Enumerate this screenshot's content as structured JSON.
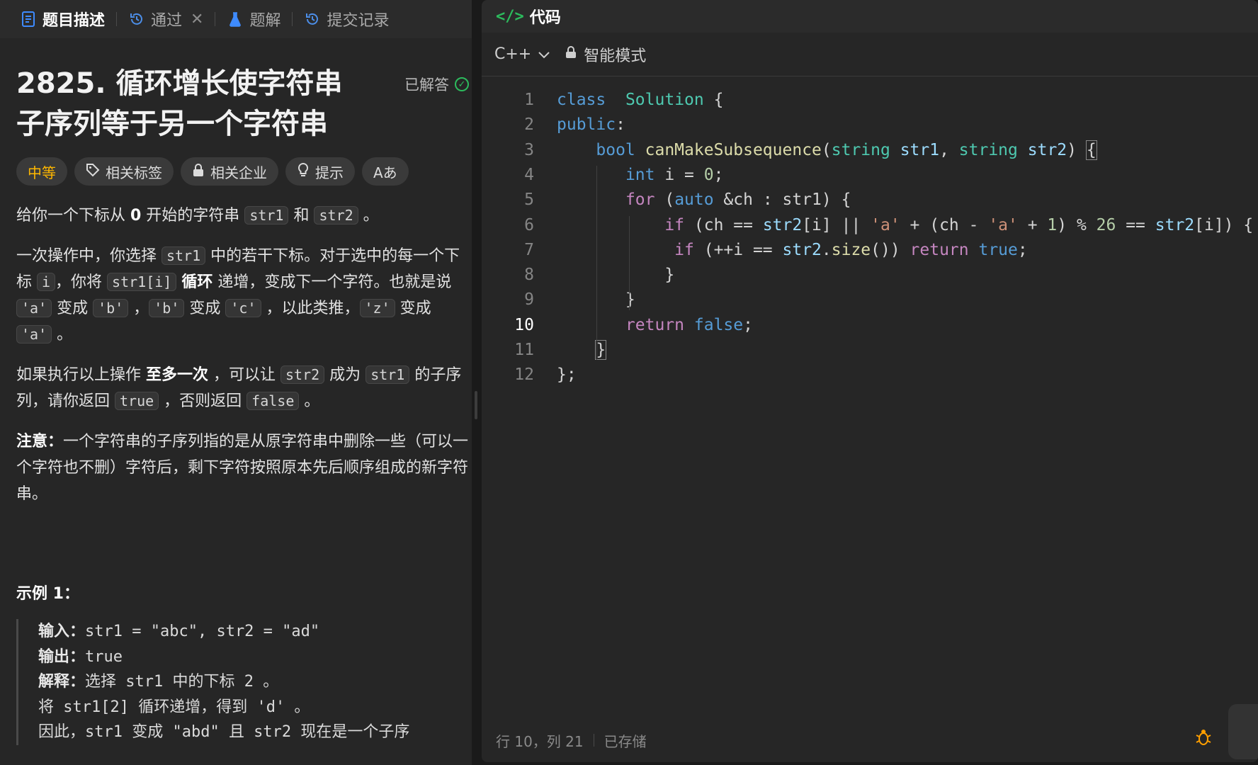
{
  "left_tabs": [
    {
      "label": "题目描述",
      "icon": "doc-icon",
      "active": true
    },
    {
      "label": "通过",
      "icon": "history-icon",
      "closable": true
    },
    {
      "label": "题解",
      "icon": "flask-icon"
    },
    {
      "label": "提交记录",
      "icon": "history-icon"
    }
  ],
  "problem": {
    "title": "2825. 循环增长使字符串子序列等于另一个字符串",
    "status": "已解答",
    "chips": [
      {
        "label": "中等",
        "icon": ""
      },
      {
        "label": "相关标签",
        "icon": "tag-icon"
      },
      {
        "label": "相关企业",
        "icon": "lock-icon"
      },
      {
        "label": "提示",
        "icon": "bulb-icon"
      },
      {
        "label": "Aあ",
        "icon": "font-size-icon"
      }
    ],
    "p1": {
      "a": "给你一个下标从 ",
      "b": "0",
      "c": " 开始的字符串 ",
      "c1": "str1",
      "d": " 和 ",
      "c2": "str2",
      "e": " 。"
    },
    "p2": {
      "a": "一次操作中，你选择 ",
      "c1": "str1",
      "b": " 中的若干下标。对于选中的每一个下标 ",
      "c2": "i",
      "c": "，你将 ",
      "c3": "str1[i]",
      "d": " ",
      "bold": "循环",
      "e": " 递增，变成下一个字符。也就是说 ",
      "c4": "'a'",
      "f": " 变成 ",
      "c5": "'b'",
      "g": " ，",
      "c6": "'b'",
      "h": " 变成 ",
      "c7": "'c'",
      "i": " ，以此类推，",
      "c8": "'z'",
      "j": " 变成 ",
      "c9": "'a'",
      "k": " 。"
    },
    "p3": {
      "a": "如果执行以上操作 ",
      "bold": "至多一次",
      "b": " ，可以让 ",
      "c1": "str2",
      "c": " 成为 ",
      "c2": "str1",
      "d": " 的子序列，请你返回 ",
      "c3": "true",
      "e": " ，否则返回 ",
      "c4": "false",
      "f": " 。"
    },
    "p4": {
      "bold": "注意：",
      "a": "一个字符串的子序列指的是从原字符串中删除一些（可以一个字符也不删）字符后，剩下字符按照原本先后顺序组成的新字符串。"
    },
    "example_title": "示例 1：",
    "example_lines": [
      {
        "k": "输入：",
        "v": "str1 = \"abc\", str2 = \"ad\""
      },
      {
        "k": "输出：",
        "v": "true"
      },
      {
        "k": "解释：",
        "v": "选择 str1 中的下标 2 。"
      },
      {
        "k": "",
        "v": "将 str1[2] 循环递增，得到 'd' 。"
      },
      {
        "k": "",
        "v": "因此，str1 变成 \"abd\" 且 str2 现在是一个子序"
      }
    ]
  },
  "editor": {
    "header_title": "代码",
    "language": "C++",
    "mode": "智能模式",
    "current_line": 10,
    "status_position": "行 10，列 21",
    "status_saved": "已存储",
    "lines": [
      [
        [
          "kw",
          "class"
        ],
        [
          "",
          "  "
        ],
        [
          "ty",
          "Solution"
        ],
        [
          "",
          " {"
        ]
      ],
      [
        [
          "kw",
          "public"
        ],
        [
          "",
          ":"
        ]
      ],
      [
        [
          "",
          "    "
        ],
        [
          "kw",
          "bool"
        ],
        [
          "",
          " "
        ],
        [
          "fn",
          "canMakeSubsequence"
        ],
        [
          "",
          "("
        ],
        [
          "ty",
          "string"
        ],
        [
          "",
          " "
        ],
        [
          "var",
          "str1"
        ],
        [
          "",
          ", "
        ],
        [
          "ty",
          "string"
        ],
        [
          "",
          " "
        ],
        [
          "var",
          "str2"
        ],
        [
          "",
          ") "
        ],
        [
          "brk",
          "{"
        ]
      ],
      [
        [
          "",
          "       "
        ],
        [
          "kw",
          "int"
        ],
        [
          "",
          " i = "
        ],
        [
          "num",
          "0"
        ],
        [
          "",
          ";"
        ]
      ],
      [
        [
          "",
          "       "
        ],
        [
          "ctrl",
          "for"
        ],
        [
          "",
          " ("
        ],
        [
          "kw",
          "auto"
        ],
        [
          "",
          " &ch : str1) {"
        ]
      ],
      [
        [
          "",
          "           "
        ],
        [
          "ctrl",
          "if"
        ],
        [
          "",
          " (ch == "
        ],
        [
          "var",
          "str2"
        ],
        [
          "",
          "[i] || "
        ],
        [
          "str",
          "'a'"
        ],
        [
          "",
          " + (ch - "
        ],
        [
          "str",
          "'a'"
        ],
        [
          "",
          " + "
        ],
        [
          "num",
          "1"
        ],
        [
          "",
          ") % "
        ],
        [
          "num",
          "26"
        ],
        [
          "",
          " == "
        ],
        [
          "var",
          "str2"
        ],
        [
          "",
          "[i]) {"
        ]
      ],
      [
        [
          "",
          "            "
        ],
        [
          "ctrl",
          "if"
        ],
        [
          "",
          " (++i == "
        ],
        [
          "var",
          "str2"
        ],
        [
          "",
          "."
        ],
        [
          "fn",
          "size"
        ],
        [
          "",
          "()) "
        ],
        [
          "ctrl",
          "return"
        ],
        [
          "",
          " "
        ],
        [
          "kw",
          "true"
        ],
        [
          "",
          ";"
        ]
      ],
      [
        [
          "",
          "           }"
        ]
      ],
      [
        [
          "",
          "       }"
        ]
      ],
      [
        [
          "",
          "       "
        ],
        [
          "ctrl",
          "return"
        ],
        [
          "",
          " "
        ],
        [
          "kw",
          "false"
        ],
        [
          "",
          ";"
        ]
      ],
      [
        [
          "",
          "    "
        ],
        [
          "brk",
          "}"
        ]
      ],
      [
        [
          "",
          "};"
        ]
      ]
    ]
  }
}
